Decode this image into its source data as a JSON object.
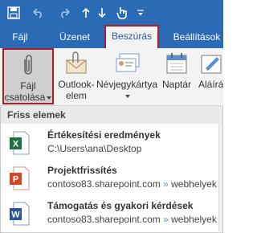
{
  "tabs": [
    {
      "label": "Fájl"
    },
    {
      "label": "Üzenet"
    },
    {
      "label": "Beszúrás"
    },
    {
      "label": "Beállítások"
    }
  ],
  "ribbon": {
    "attach_line1": "Fájl",
    "attach_line2": "csatolása",
    "outlook_line1": "Outlook-",
    "outlook_line2": "elem",
    "card": "Névjegykártya",
    "calendar": "Naptár",
    "signature": "Aláírás"
  },
  "recent": {
    "header": "Friss elemek",
    "items": [
      {
        "title": "Értékesítési eredmények",
        "path": "C:\\Users\\ana\\Desktop",
        "kind": "excel"
      },
      {
        "title": "Projektfrissítés",
        "path_host": "contoso83.sharepoint.com",
        "path_sep": "»",
        "path_tail": "webhelyek",
        "kind": "powerpoint"
      },
      {
        "title": "Támogatás és gyakori kérdések",
        "path_host": "contoso83.sharepoint.com",
        "path_sep": "»",
        "path_tail": "webhelyek",
        "kind": "word"
      }
    ]
  },
  "colors": {
    "titlebar": "#2b6ab5",
    "highlight": "#a8202a",
    "excel": "#1e7145",
    "powerpoint": "#d24726",
    "word": "#2b579a"
  }
}
